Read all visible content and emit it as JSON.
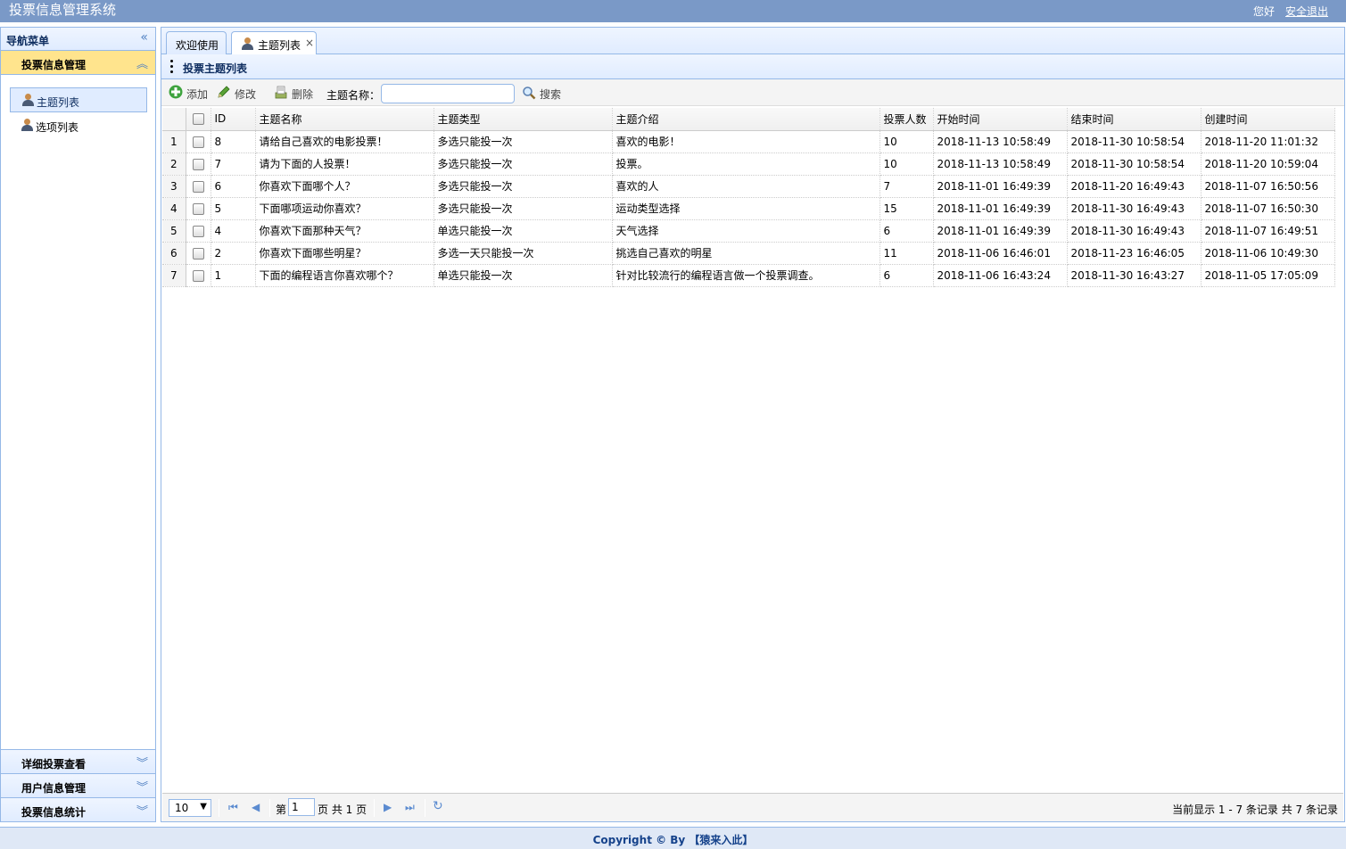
{
  "header": {
    "title": "投票信息管理系统",
    "greeting": "您好",
    "logout": "安全退出"
  },
  "sidebar": {
    "title": "导航菜单",
    "sections": [
      {
        "label": "投票信息管理",
        "items": [
          "主题列表",
          "选项列表"
        ]
      },
      {
        "label": "详细投票查看"
      },
      {
        "label": "用户信息管理"
      },
      {
        "label": "投票信息统计"
      }
    ]
  },
  "tabs": [
    {
      "label": "欢迎使用"
    },
    {
      "label": "主题列表"
    }
  ],
  "panel": {
    "title": "投票主题列表"
  },
  "toolbar": {
    "add": "添加",
    "edit": "修改",
    "delete": "删除",
    "search_label": "主题名称：",
    "search_value": "",
    "search_button": "搜索"
  },
  "grid": {
    "columns": [
      "ID",
      "主题名称",
      "主题类型",
      "主题介绍",
      "投票人数",
      "开始时间",
      "结束时间",
      "创建时间"
    ],
    "rows": [
      {
        "n": "1",
        "id": "8",
        "name": "请给自己喜欢的电影投票！",
        "type": "多选只能投一次",
        "desc": "喜欢的电影！",
        "votes": "10",
        "start": "2018-11-13 10:58:49",
        "end": "2018-11-30 10:58:54",
        "created": "2018-11-20 11:01:32"
      },
      {
        "n": "2",
        "id": "7",
        "name": "请为下面的人投票！",
        "type": "多选只能投一次",
        "desc": "投票。",
        "votes": "10",
        "start": "2018-11-13 10:58:49",
        "end": "2018-11-30 10:58:54",
        "created": "2018-11-20 10:59:04"
      },
      {
        "n": "3",
        "id": "6",
        "name": "你喜欢下面哪个人？",
        "type": "多选只能投一次",
        "desc": "喜欢的人",
        "votes": "7",
        "start": "2018-11-01 16:49:39",
        "end": "2018-11-20 16:49:43",
        "created": "2018-11-07 16:50:56"
      },
      {
        "n": "4",
        "id": "5",
        "name": "下面哪项运动你喜欢？",
        "type": "多选只能投一次",
        "desc": "运动类型选择",
        "votes": "15",
        "start": "2018-11-01 16:49:39",
        "end": "2018-11-30 16:49:43",
        "created": "2018-11-07 16:50:30"
      },
      {
        "n": "5",
        "id": "4",
        "name": "你喜欢下面那种天气？",
        "type": "单选只能投一次",
        "desc": "天气选择",
        "votes": "6",
        "start": "2018-11-01 16:49:39",
        "end": "2018-11-30 16:49:43",
        "created": "2018-11-07 16:49:51"
      },
      {
        "n": "6",
        "id": "2",
        "name": "你喜欢下面哪些明星？",
        "type": "多选一天只能投一次",
        "desc": "挑选自己喜欢的明星",
        "votes": "11",
        "start": "2018-11-06 16:46:01",
        "end": "2018-11-23 16:46:05",
        "created": "2018-11-06 10:49:30"
      },
      {
        "n": "7",
        "id": "1",
        "name": "下面的编程语言你喜欢哪个？",
        "type": "单选只能投一次",
        "desc": "针对比较流行的编程语言做一个投票调查。",
        "votes": "6",
        "start": "2018-11-06 16:43:24",
        "end": "2018-11-30 16:43:27",
        "created": "2018-11-05 17:05:09"
      }
    ]
  },
  "pager": {
    "page_size": "10",
    "page_prefix": "第",
    "page_value": "1",
    "page_suffix": "页 共 1 页",
    "info": "当前显示 1 - 7 条记录 共 7 条记录"
  },
  "footer": {
    "text": "Copyright © By 【猿来入此】"
  }
}
